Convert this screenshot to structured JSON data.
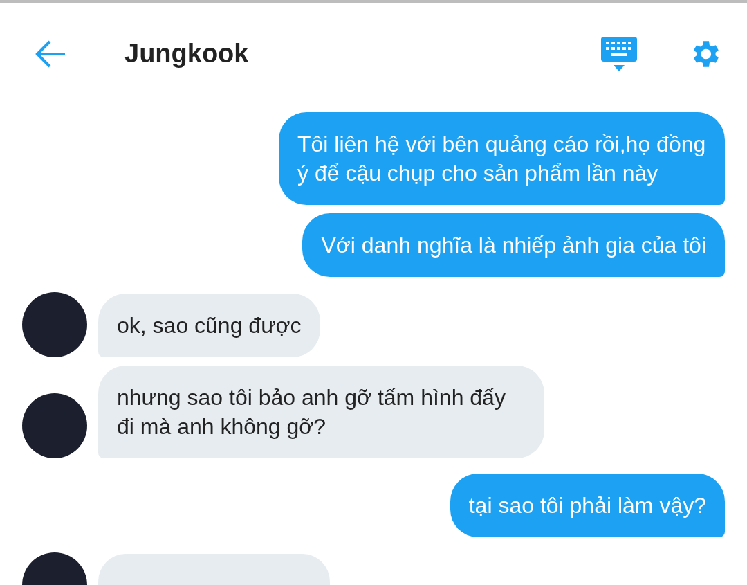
{
  "header": {
    "title": "Jungkook"
  },
  "messages": [
    {
      "kind": "sent",
      "text": "Tôi liên hệ với bên quảng cáo rồi,họ đồng ý để cậu chụp cho sản phẩm lần này"
    },
    {
      "kind": "sent",
      "text": "Với danh nghĩa là nhiếp ảnh gia của tôi"
    },
    {
      "kind": "received",
      "text": "ok, sao cũng được"
    },
    {
      "kind": "received",
      "text": "nhưng sao tôi bảo anh gỡ tấm hình đấy đi mà anh không gỡ?"
    },
    {
      "kind": "sent",
      "text": "tại sao tôi phải làm vậy?"
    },
    {
      "kind": "received"
    }
  ]
}
